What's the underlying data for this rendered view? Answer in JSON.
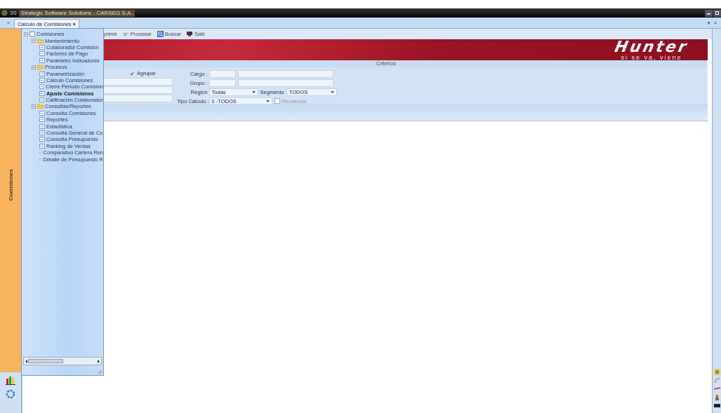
{
  "window": {
    "title": "Strategic Software Solutions - CARSEG S.A.",
    "app_badge": "3S"
  },
  "document_tabs": {
    "overflow": "»",
    "tabs": [
      {
        "label": "Cálculo de Comisiones",
        "close": "×",
        "selected": true
      }
    ],
    "menu": "▾",
    "close": "×"
  },
  "side_strip": {
    "label": "Comisiones"
  },
  "toolbar": [
    {
      "label": "primir"
    },
    {
      "label": "Procesar"
    },
    {
      "label": "Buscar"
    },
    {
      "label": "Salir"
    }
  ],
  "banner": {
    "brand": "Hunter",
    "slogan": "si se va, viene"
  },
  "criteria": {
    "title": "Criterios",
    "agrupar": {
      "label": "Agrupar",
      "checked": true
    },
    "cargo": {
      "label": "Cargo :"
    },
    "grupo": {
      "label": "Grupo :"
    },
    "region": {
      "label": "Región",
      "value": "Todas"
    },
    "segmento": {
      "label": "Segmento",
      "value": "TODOS"
    },
    "tipo_calculo": {
      "label": "Tipo Cálculo :",
      "value": "0 -TODOS"
    },
    "recalcular": {
      "label": "Recalcular",
      "checked": false,
      "disabled": true
    }
  },
  "tree": [
    {
      "label": "Comisiones",
      "kind": "root",
      "expanded": true,
      "selected": false,
      "children": [
        {
          "label": "Mantenimiento",
          "kind": "folder",
          "expanded": true,
          "selected": false,
          "children": [
            {
              "label": "Colaborador Comisión",
              "kind": "page",
              "selected": false
            },
            {
              "label": "Factores de Pago",
              "kind": "page",
              "selected": false
            },
            {
              "label": "Parámetro Indicadores",
              "kind": "page",
              "selected": false
            }
          ]
        },
        {
          "label": "Procesos",
          "kind": "folder",
          "expanded": true,
          "selected": false,
          "children": [
            {
              "label": "Parametrización",
              "kind": "page",
              "selected": false
            },
            {
              "label": "Cálculo Comisiones",
              "kind": "page",
              "selected": false
            },
            {
              "label": "Cierre Periodo Comisión",
              "kind": "page",
              "selected": false
            },
            {
              "label": "Ajuste Comisiones",
              "kind": "page",
              "selected": true
            },
            {
              "label": "Calificación Colaborador",
              "kind": "page",
              "selected": false
            }
          ]
        },
        {
          "label": "Consultas/Reportes",
          "kind": "folder",
          "expanded": true,
          "selected": false,
          "children": [
            {
              "label": "Consulta Comisiones",
              "kind": "page",
              "selected": false
            },
            {
              "label": "Reportes",
              "kind": "page",
              "selected": false
            },
            {
              "label": "Estadística",
              "kind": "page",
              "selected": false
            },
            {
              "label": "Consulta General de Co",
              "kind": "page",
              "selected": false
            },
            {
              "label": "Consulta Presupuesto",
              "kind": "page",
              "selected": false
            },
            {
              "label": "Ranking de Ventas",
              "kind": "page",
              "selected": false
            },
            {
              "label": "Comparativo Cartera Ren",
              "kind": "page",
              "selected": false
            },
            {
              "label": "Detalle de Presupuesto R",
              "kind": "page",
              "selected": false
            }
          ]
        }
      ]
    }
  ]
}
